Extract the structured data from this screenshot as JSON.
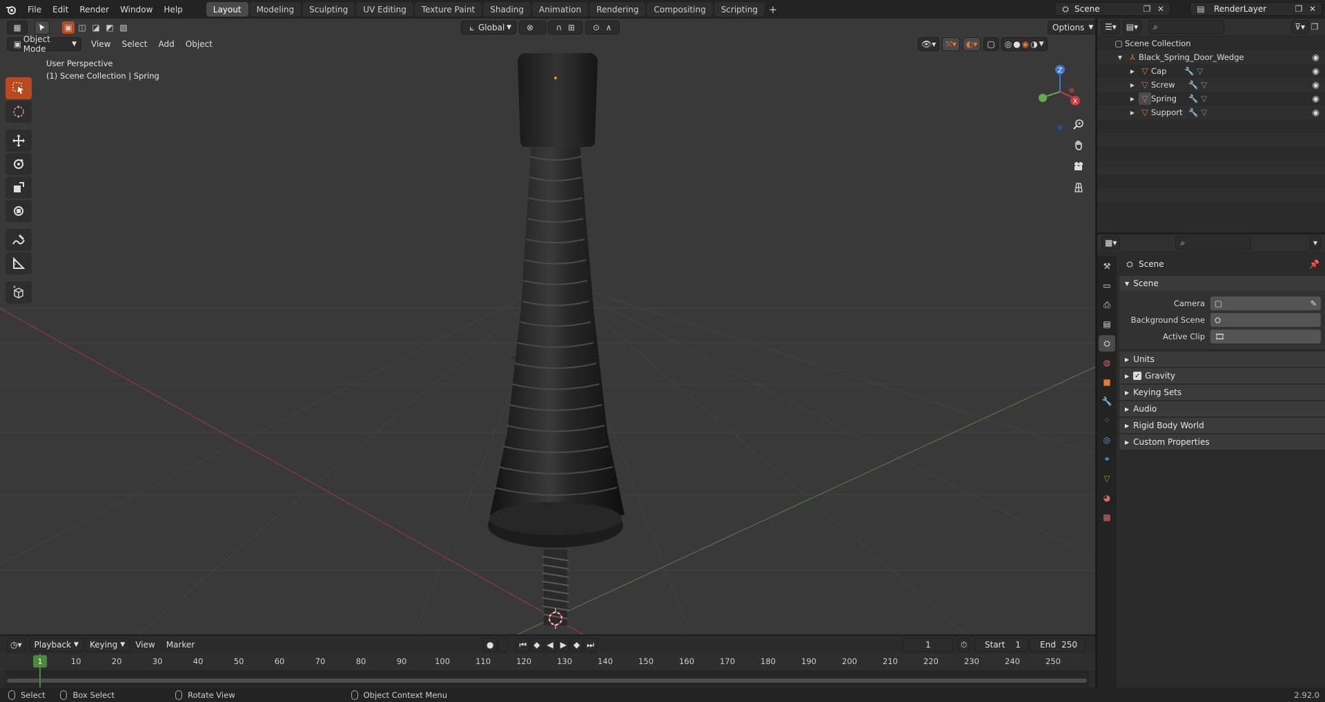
{
  "topbar": {
    "menus": [
      "File",
      "Edit",
      "Render",
      "Window",
      "Help"
    ],
    "workspaces": [
      "Layout",
      "Modeling",
      "Sculpting",
      "UV Editing",
      "Texture Paint",
      "Shading",
      "Animation",
      "Rendering",
      "Compositing",
      "Scripting"
    ],
    "active_workspace": "Layout",
    "scene_label": "Scene",
    "view_layer_label": "RenderLayer"
  },
  "viewport": {
    "mode": "Object Mode",
    "menus": [
      "View",
      "Select",
      "Add",
      "Object"
    ],
    "transform_orientation": "Global",
    "options_label": "Options",
    "overlay_title": "User Perspective",
    "overlay_subtitle": "(1) Scene Collection | Spring",
    "gizmo_axes": {
      "z": "Z",
      "x": "X"
    }
  },
  "outliner": {
    "root": "Scene Collection",
    "collection": "Black_Spring_Door_Wedge",
    "objects": [
      "Cap",
      "Screw",
      "Spring",
      "Support"
    ]
  },
  "properties": {
    "header": "Scene",
    "panel_scene": "Scene",
    "fields": {
      "camera_label": "Camera",
      "background_scene_label": "Background Scene",
      "active_clip_label": "Active Clip"
    },
    "subpanels": [
      "Units",
      "Gravity",
      "Keying Sets",
      "Audio",
      "Rigid Body World",
      "Custom Properties"
    ]
  },
  "timeline": {
    "menus": [
      "Playback",
      "Keying",
      "View",
      "Marker"
    ],
    "current_frame": "1",
    "start_label": "Start",
    "start_value": "1",
    "end_label": "End",
    "end_value": "250",
    "ticks": [
      "1",
      "10",
      "20",
      "30",
      "40",
      "50",
      "60",
      "70",
      "80",
      "90",
      "100",
      "110",
      "120",
      "130",
      "140",
      "150",
      "160",
      "170",
      "180",
      "190",
      "200",
      "210",
      "220",
      "230",
      "240",
      "250"
    ]
  },
  "statusbar": {
    "select": "Select",
    "box_select": "Box Select",
    "rotate_view": "Rotate View",
    "context_menu": "Object Context Menu",
    "version": "2.92.0"
  },
  "colors": {
    "accent": "#4f6da0",
    "x_axis": "#c83c3c",
    "y_axis": "#6aa84f",
    "z_axis": "#3c78d8",
    "object_orange": "#e07b39"
  }
}
